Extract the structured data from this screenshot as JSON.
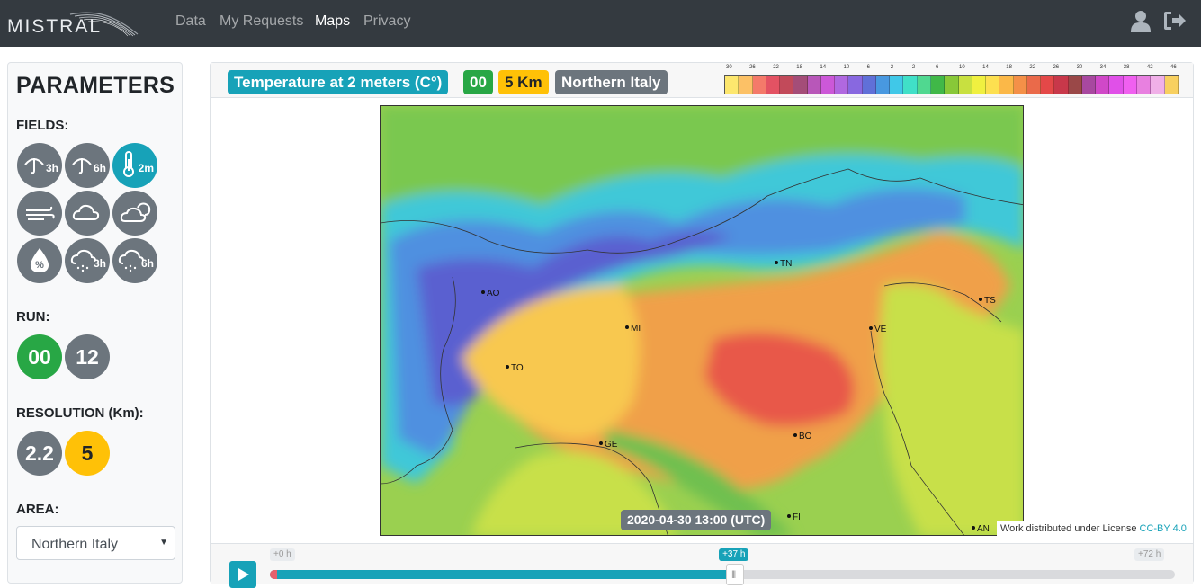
{
  "navbar": {
    "brand": "MISTRAL",
    "links": [
      {
        "label": "Data",
        "active": false
      },
      {
        "label": "My Requests",
        "active": false
      },
      {
        "label": "Maps",
        "active": true
      },
      {
        "label": "Privacy",
        "active": false
      }
    ],
    "icons": [
      "user-icon",
      "sign-out-icon"
    ]
  },
  "sidebar": {
    "title": "PARAMETERS",
    "fields_label": "FIELDS:",
    "fields": [
      {
        "icon": "umbrella-icon",
        "sub": "3h",
        "active": false
      },
      {
        "icon": "umbrella-icon",
        "sub": "6h",
        "active": false
      },
      {
        "icon": "thermometer-icon",
        "sub": "2m",
        "active": true
      },
      {
        "icon": "wind-icon",
        "sub": "",
        "active": false
      },
      {
        "icon": "cloud-icon",
        "sub": "",
        "active": false
      },
      {
        "icon": "clouds-icon",
        "sub": "",
        "active": false
      },
      {
        "icon": "humidity-icon",
        "sub": "",
        "active": false
      },
      {
        "icon": "snow-cloud-icon",
        "sub": "3h",
        "active": false
      },
      {
        "icon": "snow-cloud-icon",
        "sub": "6h",
        "active": false
      }
    ],
    "run_label": "RUN:",
    "runs": [
      {
        "label": "00",
        "active": true
      },
      {
        "label": "12",
        "active": false
      }
    ],
    "resolution_label": "RESOLUTION (Km):",
    "resolutions": [
      {
        "label": "2.2",
        "active": false
      },
      {
        "label": "5",
        "active": true
      }
    ],
    "area_label": "AREA:",
    "area_value": "Northern Italy"
  },
  "map_header": {
    "field": "Temperature at 2 meters (C°)",
    "run": "00",
    "resolution": "5 Km",
    "area": "Northern Italy"
  },
  "legend": {
    "ticks": [
      "-30",
      "-26",
      "-22",
      "-18",
      "-14",
      "-10",
      "-6",
      "-2",
      "2",
      "6",
      "10",
      "14",
      "18",
      "22",
      "26",
      "30",
      "34",
      "38",
      "42",
      "46"
    ],
    "colors": [
      "#fde76e",
      "#fcc166",
      "#f47a6a",
      "#e35263",
      "#c24a5a",
      "#a44d78",
      "#b857b9",
      "#cc58d8",
      "#b068e0",
      "#8868e0",
      "#6070d8",
      "#4898e0",
      "#40c8e8",
      "#40e0c8",
      "#50d890",
      "#40b848",
      "#88c838",
      "#c8e040",
      "#f0f040",
      "#fde050",
      "#fbb848",
      "#f49048",
      "#ea6a4a",
      "#e44848",
      "#c8384a",
      "#9a4848",
      "#a848a0",
      "#d048c8",
      "#e050e8",
      "#f060f0",
      "#e880e0",
      "#f0b0e8",
      "#f8d060"
    ]
  },
  "map": {
    "timestamp": "2020-04-30 13:00 (UTC)",
    "license_text": "Work distributed under License ",
    "license_link": "CC-BY 4.0",
    "cities": [
      {
        "code": "AO"
      },
      {
        "code": "TO"
      },
      {
        "code": "MI"
      },
      {
        "code": "TN"
      },
      {
        "code": "VE"
      },
      {
        "code": "TS"
      },
      {
        "code": "GE"
      },
      {
        "code": "BO"
      },
      {
        "code": "FI"
      },
      {
        "code": "AN"
      }
    ]
  },
  "timeline": {
    "start_label": "+0 h",
    "current_label": "+37 h",
    "end_label": "+72 h",
    "current_fraction": 0.514
  }
}
